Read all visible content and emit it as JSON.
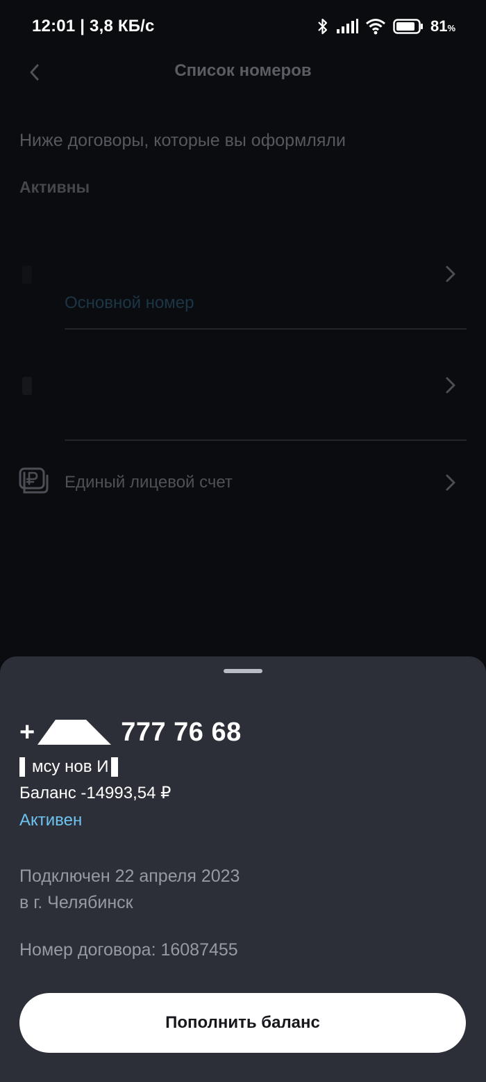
{
  "status_bar": {
    "time": "12:01 | 3,8 КБ/с",
    "battery_percent": "81",
    "battery_symbol": "%",
    "icons": [
      "bluetooth-icon",
      "signal-icon",
      "wifi-icon",
      "battery-icon"
    ]
  },
  "header": {
    "title": "Список номеров",
    "back_icon": "chevron-left-icon"
  },
  "page": {
    "subtitle": "Ниже договоры, которые вы оформляли",
    "section_title": "Активны"
  },
  "list": {
    "items": [
      {
        "sub_label": "Основной номер"
      },
      {
        "sub_label": ""
      }
    ],
    "account_item": {
      "label": "Единый лицевой счет",
      "icon": "ruble-card-icon"
    }
  },
  "sheet": {
    "phone_prefix": "+",
    "phone_number": "777 76 68",
    "owner_name": "мсу  нов И",
    "balance": "Баланс -14993,54 ₽",
    "status": "Активен",
    "connected": "Подключен 22 апреля 2023",
    "city": "в г. Челябинск",
    "contract": "Номер договора: 16087455",
    "topup_button": "Пополнить баланс"
  },
  "colors": {
    "background": "#0b0c10",
    "sheet": "#2c2f37",
    "accent_active": "#6dc3f2",
    "button_bg": "#ffffff"
  }
}
